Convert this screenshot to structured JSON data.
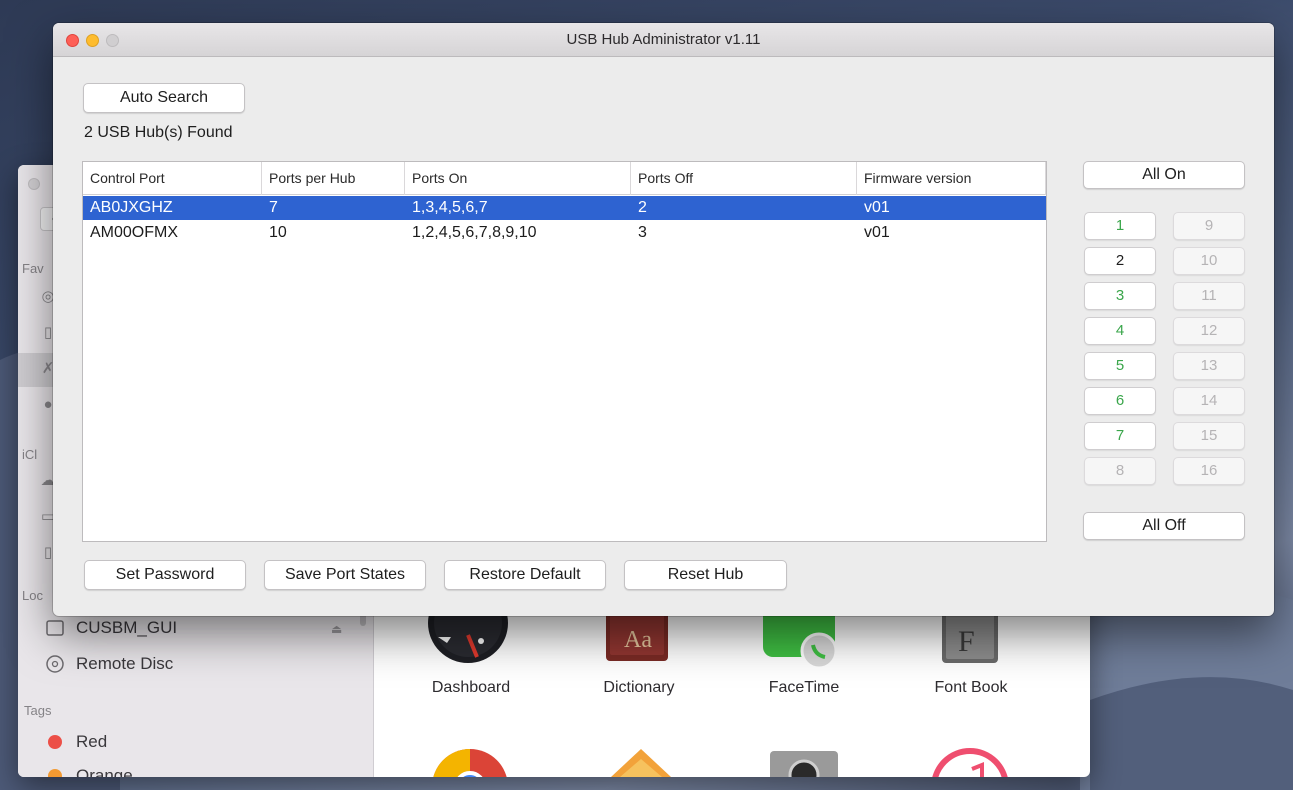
{
  "window": {
    "title": "USB Hub Administrator v1.11"
  },
  "toolbar": {
    "auto_search_label": "Auto Search",
    "hub_count_text": "2 USB Hub(s) Found"
  },
  "table": {
    "columns": [
      "Control Port",
      "Ports per Hub",
      "Ports On",
      "Ports Off",
      "Firmware version"
    ],
    "rows": [
      {
        "control_port": "AB0JXGHZ",
        "ports_per_hub": "7",
        "ports_on": "1,3,4,5,6,7",
        "ports_off": "2",
        "firmware": "v01",
        "selected": true
      },
      {
        "control_port": "AM00OFMX",
        "ports_per_hub": "10",
        "ports_on": "1,2,4,5,6,7,8,9,10",
        "ports_off": "3",
        "firmware": "v01",
        "selected": false
      }
    ]
  },
  "ports_panel": {
    "all_on_label": "All On",
    "all_off_label": "All Off",
    "left_column": [
      {
        "label": "1",
        "state": "on"
      },
      {
        "label": "2",
        "state": "off"
      },
      {
        "label": "3",
        "state": "on"
      },
      {
        "label": "4",
        "state": "on"
      },
      {
        "label": "5",
        "state": "on"
      },
      {
        "label": "6",
        "state": "on"
      },
      {
        "label": "7",
        "state": "on"
      },
      {
        "label": "8",
        "state": "unavailable"
      }
    ],
    "right_column": [
      {
        "label": "9",
        "state": "unavailable"
      },
      {
        "label": "10",
        "state": "unavailable"
      },
      {
        "label": "11",
        "state": "unavailable"
      },
      {
        "label": "12",
        "state": "unavailable"
      },
      {
        "label": "13",
        "state": "unavailable"
      },
      {
        "label": "14",
        "state": "unavailable"
      },
      {
        "label": "15",
        "state": "unavailable"
      },
      {
        "label": "16",
        "state": "unavailable"
      }
    ]
  },
  "footer": {
    "set_password_label": "Set Password",
    "save_port_states_label": "Save Port States",
    "restore_default_label": "Restore Default",
    "reset_hub_label": "Reset Hub"
  },
  "finder": {
    "sidebar_fragments": {
      "favorites": "Fav",
      "icloud": "iCl",
      "locations": "Loc"
    },
    "locations": [
      "CUSBM_GUI",
      "Remote Disc"
    ],
    "tags_header": "Tags",
    "tags": [
      {
        "name": "Red",
        "color": "#ec4f47"
      },
      {
        "name": "Orange",
        "color": "#f39a32"
      }
    ],
    "apps": [
      "Dashboard",
      "Dictionary",
      "FaceTime",
      "Font Book"
    ]
  },
  "colors": {
    "selection": "#2e63d1",
    "port_on": "#3aa64b",
    "port_unavailable": "#b5b3b5"
  }
}
